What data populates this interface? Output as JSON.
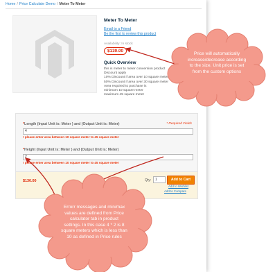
{
  "breadcrumb": {
    "home": "Home",
    "category": "Price Calculate Demo",
    "current": "Meter To Meter",
    "separator": "/"
  },
  "product": {
    "title": "Meter To Meter",
    "email_friend": "Email to a Friend",
    "first_review": "Be the first to review this product",
    "availability": "Availability: In stock",
    "price": "$130.00",
    "quick_overview_title": "Quick Overview",
    "description_lines": [
      "this is meter to meter conversion product",
      "Discount apply",
      "10% Discount if area over 10 square meter",
      "50% Discount if area over 30 square meter",
      "Area required to purchase is",
      "minimum 10 square meter",
      "maximum 45 square meter"
    ]
  },
  "options": {
    "length_label": "Length (Input Unit is: Meter ) and (Output Unit is: Meter)",
    "length_value": "4",
    "height_label": "Height (Input Unit is: Meter ) and (Output Unit is: Meter)",
    "height_value": "2",
    "required_marker": "*",
    "required_fields": "* Required Fields",
    "error_message": "please enter area between 10 square meter to 45 square meter",
    "error_icon": "!"
  },
  "cart": {
    "price": "$130.00",
    "qty_label": "Qty:",
    "qty_value": "1",
    "add_to_cart": "Add to Cart",
    "add_to_wishlist": "Add to Wishlist",
    "add_to_compare": "Add to Compare"
  },
  "callouts": {
    "price_note": [
      "Price will automatically",
      "increase/decrease according",
      "to the size. Unit price is set",
      "from the custom options"
    ],
    "error_note": [
      "Errorr messages and min/max",
      "values are defined from Price",
      "calculator tab in product",
      "settings. In this case 4 * 2 is 8",
      "square meters which is less than",
      "10 as defined in Price rules"
    ]
  },
  "colors": {
    "link": "#1e7ec8",
    "price_red": "#df280a",
    "error_red": "#eb340a",
    "cart_button": "#f18200",
    "cloud_fill": "#f49a8c",
    "cloud_stroke": "#e47f70",
    "arrow": "#c0281f"
  }
}
